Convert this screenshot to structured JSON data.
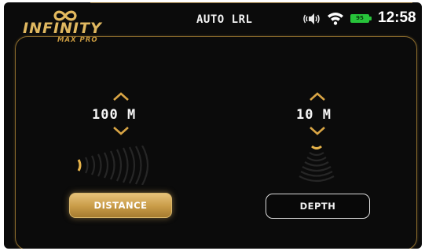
{
  "app": {
    "logo_text": "INFINITY",
    "logo_subtext": "MAX PRO",
    "mode_title": "AUTO LRL"
  },
  "status_bar": {
    "battery_percent": "95",
    "time": "12:58",
    "icons": [
      "speaker-icon",
      "wifi-icon",
      "battery-icon"
    ]
  },
  "distance": {
    "value": "100 M",
    "button_label": "DISTANCE",
    "selected": true
  },
  "depth": {
    "value": "10 M",
    "button_label": "DEPTH",
    "selected": false
  },
  "colors": {
    "background": "#0b0b0b",
    "gold_accent": "#d4a24c",
    "frame_gold": "#8a6a2c",
    "battery_green": "#27c33a",
    "text": "#ffffff"
  }
}
